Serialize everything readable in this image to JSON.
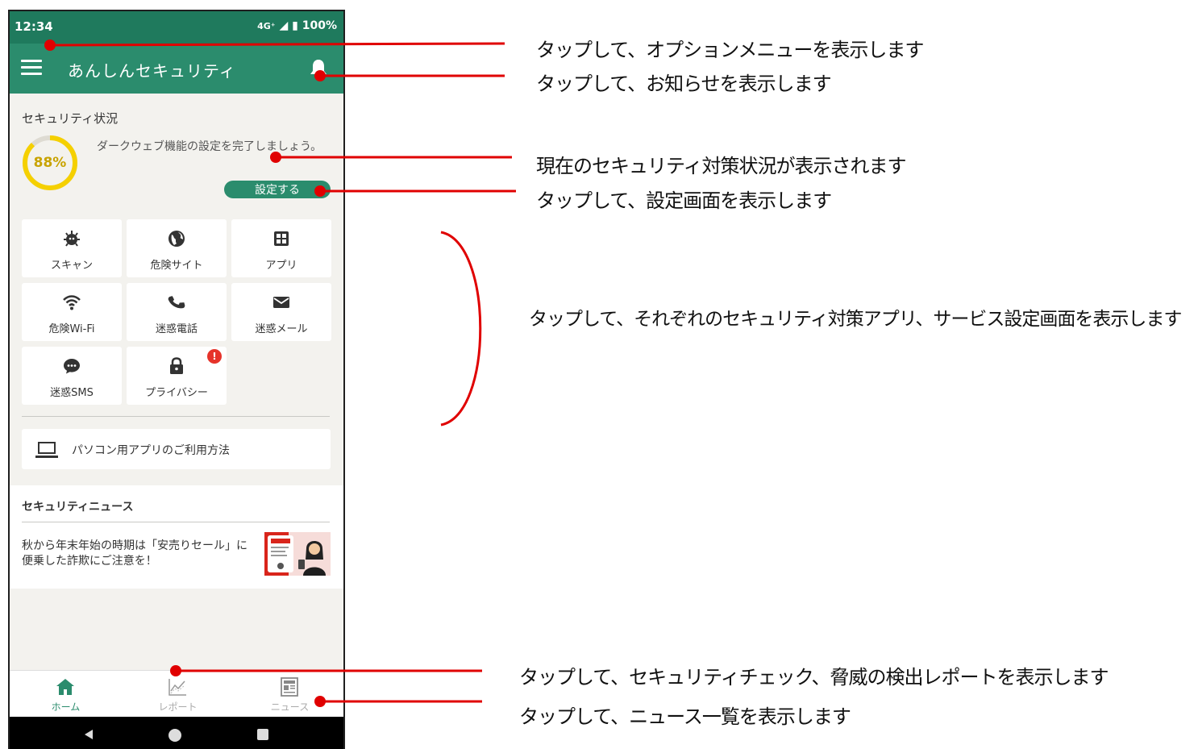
{
  "status_bar": {
    "time": "12:34",
    "network": "4G⁺",
    "battery": "100%"
  },
  "app_bar": {
    "title": "あんしんセキュリティ",
    "menu_icon": "hamburger-menu-icon",
    "bell_icon": "bell-icon"
  },
  "security": {
    "title": "セキュリティ状況",
    "score": "88%",
    "score_value": 0.88,
    "message": "ダークウェブ機能の設定を完了しましょう。",
    "button": "設定する"
  },
  "tiles": [
    {
      "label": "スキャン",
      "icon": "virus-icon"
    },
    {
      "label": "危険サイト",
      "icon": "globe-icon"
    },
    {
      "label": "アプリ",
      "icon": "apps-grid-icon"
    },
    {
      "label": "危険Wi-Fi",
      "icon": "wifi-icon"
    },
    {
      "label": "迷惑電話",
      "icon": "phone-icon"
    },
    {
      "label": "迷惑メール",
      "icon": "mail-icon"
    },
    {
      "label": "迷惑SMS",
      "icon": "chat-bubble-icon"
    },
    {
      "label": "プライバシー",
      "icon": "lock-icon",
      "badge": "!"
    }
  ],
  "pc_app": {
    "label": "パソコン用アプリのご利用方法",
    "icon": "laptop-icon"
  },
  "news": {
    "title": "セキュリティニュース",
    "item_text": "秋から年末年始の時期は「安売りセール」に便乗した詐欺にご注意を！"
  },
  "bottom_nav": [
    {
      "label": "ホーム",
      "icon": "home-icon",
      "active": true
    },
    {
      "label": "レポート",
      "icon": "chart-icon",
      "active": false
    },
    {
      "label": "ニュース",
      "icon": "newspaper-icon",
      "active": false
    }
  ],
  "annotations": {
    "options_menu": "タップして、オプションメニューを表示します",
    "notifications": "タップして、お知らせを表示します",
    "security_status": "現在のセキュリティ対策状況が表示されます",
    "settings": "タップして、設定画面を表示します",
    "tiles": "タップして、それぞれのセキュリティ対策アプリ、サービス設定画面を表示します",
    "report": "タップして、セキュリティチェック、脅威の検出レポートを表示します",
    "news_list": "タップして、ニュース一覧を表示します"
  },
  "colors": {
    "primary": "#2b8c6d",
    "statusbar": "#1f7a5d",
    "gauge": "#f5d000",
    "annotation": "#e00000",
    "badge": "#e6332a"
  }
}
